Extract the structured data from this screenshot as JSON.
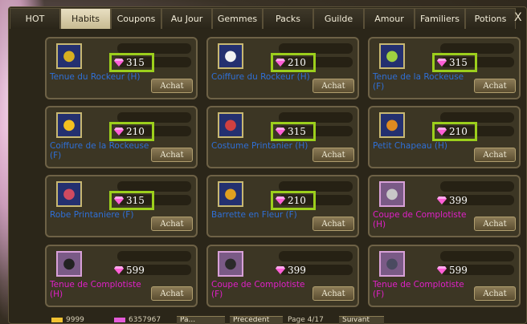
{
  "tabs": [
    {
      "label": "HOT",
      "active": false
    },
    {
      "label": "Habits",
      "active": true
    },
    {
      "label": "Coupons",
      "active": false
    },
    {
      "label": "Au Jour",
      "active": false
    },
    {
      "label": "Gemmes",
      "active": false
    },
    {
      "label": "Packs",
      "active": false
    },
    {
      "label": "Guilde",
      "active": false
    },
    {
      "label": "Amour",
      "active": false
    },
    {
      "label": "Familiers",
      "active": false
    },
    {
      "label": "Potions",
      "active": false
    }
  ],
  "close_label": "X",
  "buy_label": "Achat",
  "items": [
    {
      "name": "Tenue du Rockeur (H)",
      "price": "315",
      "highlighted": true,
      "color": "blue",
      "icon": "outfit-icon",
      "icon_color": "#d8b020"
    },
    {
      "name": "Coiffure du Rockeur (H)",
      "price": "210",
      "highlighted": true,
      "color": "blue",
      "icon": "hair-icon",
      "icon_color": "#f2f2f2"
    },
    {
      "name": "Tenue de la Rockeuse (F)",
      "price": "315",
      "highlighted": true,
      "color": "blue",
      "icon": "outfit-icon",
      "icon_color": "#9fd040"
    },
    {
      "name": "Coiffure de la Rockeuse (F)",
      "price": "210",
      "highlighted": true,
      "color": "blue",
      "icon": "hair-icon",
      "icon_color": "#f2c020"
    },
    {
      "name": "Costume Printanier (H)",
      "price": "315",
      "highlighted": true,
      "color": "blue",
      "icon": "outfit-icon",
      "icon_color": "#d04040"
    },
    {
      "name": "Petit Chapeau (H)",
      "price": "210",
      "highlighted": true,
      "color": "blue",
      "icon": "hat-icon",
      "icon_color": "#e08a20"
    },
    {
      "name": "Robe Printaniere (F)",
      "price": "315",
      "highlighted": true,
      "color": "blue",
      "icon": "dress-icon",
      "icon_color": "#d04a60"
    },
    {
      "name": "Barrette en Fleur (F)",
      "price": "210",
      "highlighted": true,
      "color": "blue",
      "icon": "hairclip-icon",
      "icon_color": "#e0a020"
    },
    {
      "name": "Coupe de Complotiste (H)",
      "price": "399",
      "highlighted": false,
      "color": "pink",
      "icon": "hair-icon",
      "icon_color": "#c8c8c8"
    },
    {
      "name": "Tenue de Complotiste (H)",
      "price": "599",
      "highlighted": false,
      "color": "pink",
      "icon": "outfit-icon",
      "icon_color": "#222222"
    },
    {
      "name": "Coupe de Complotiste (F)",
      "price": "399",
      "highlighted": false,
      "color": "pink",
      "icon": "hair-icon",
      "icon_color": "#2a2a2a"
    },
    {
      "name": "Tenue de Complotiste (F)",
      "price": "599",
      "highlighted": false,
      "color": "pink",
      "icon": "outfit-icon",
      "icon_color": "#4a4a60"
    }
  ],
  "footer": {
    "gold": "9999",
    "gems": "6357967",
    "btn1": "Pa...",
    "prev": "Précédent",
    "page": "Page 4/17",
    "next": "Suivant"
  },
  "colors": {
    "highlight": "#9ccf1c",
    "name_blue": "#2f6fd6",
    "name_pink": "#e020c8"
  }
}
